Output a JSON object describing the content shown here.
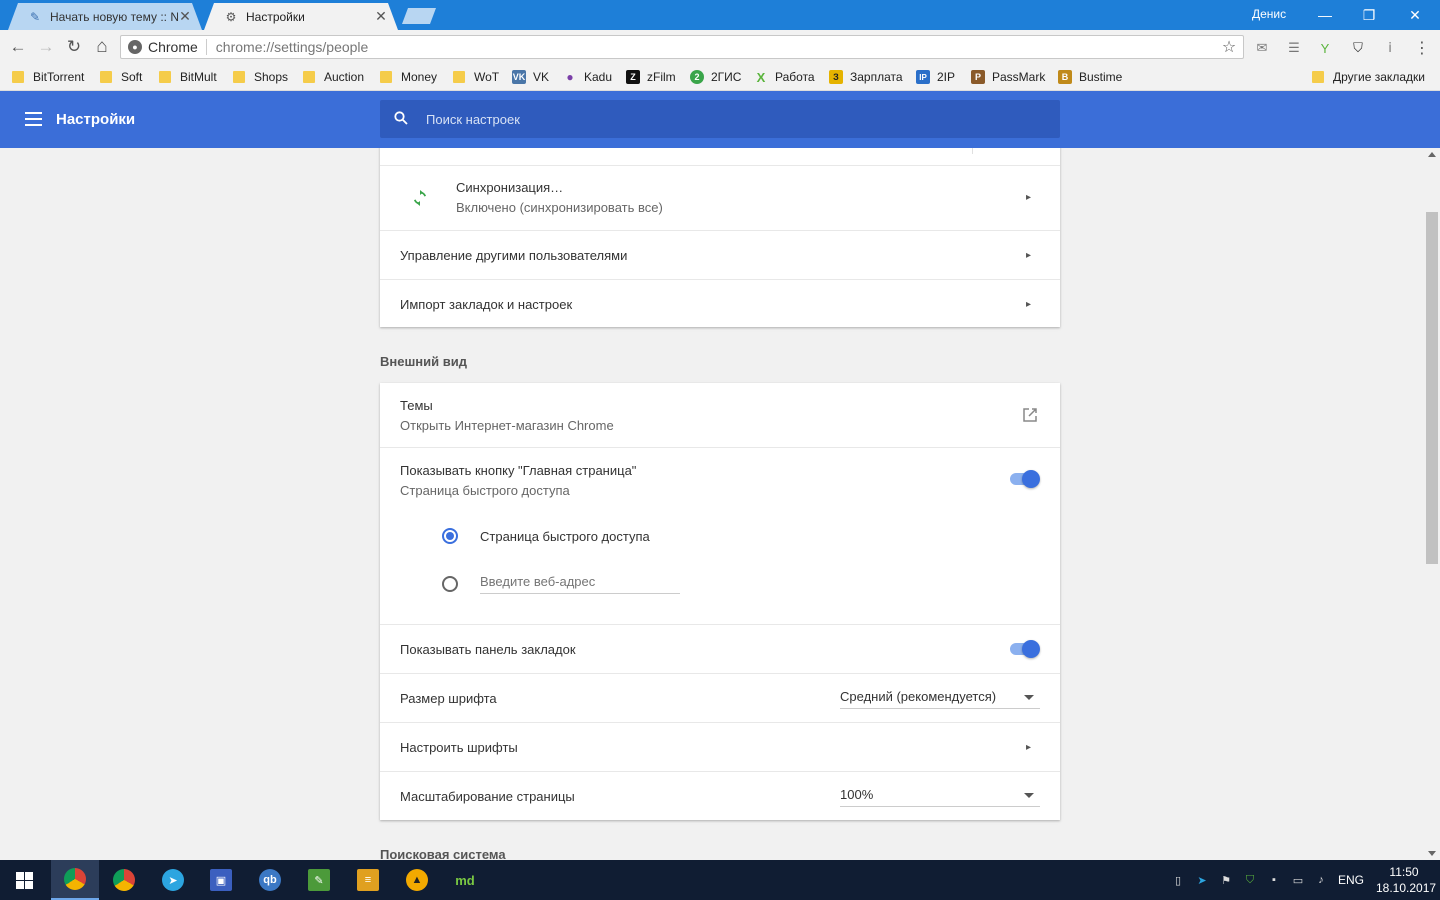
{
  "window": {
    "user_name": "Денис",
    "minimize": "—",
    "maximize": "❐",
    "close": "✕"
  },
  "tabs": [
    {
      "title": "Начать новую тему :: N",
      "close": "✕"
    },
    {
      "title": "Настройки",
      "close": "✕"
    }
  ],
  "toolbar": {
    "back": "←",
    "forward": "→",
    "reload": "↻",
    "home": "⌂",
    "site_chip": "Chrome",
    "url": "chrome://settings/people",
    "star": "☆",
    "menu": "⋮"
  },
  "bookmarks": [
    {
      "label": "BitTorrent",
      "icon": "folder-icon"
    },
    {
      "label": "Soft",
      "icon": "folder-icon"
    },
    {
      "label": "BitMult",
      "icon": "folder-icon"
    },
    {
      "label": "Shops",
      "icon": "folder-icon"
    },
    {
      "label": "Auction",
      "icon": "folder-icon"
    },
    {
      "label": "Money",
      "icon": "folder-icon"
    },
    {
      "label": "WoT",
      "icon": "folder-icon"
    },
    {
      "label": "VK",
      "icon": "vk-icon",
      "glyph": "VK",
      "color": "#4a76a8"
    },
    {
      "label": "Kadu",
      "icon": "kadu-icon",
      "glyph": "●",
      "color": "#7b3fa8"
    },
    {
      "label": "zFilm",
      "icon": "zfilm-icon",
      "glyph": "Z",
      "color": "#111111"
    },
    {
      "label": "2ГИС",
      "icon": "2gis-icon",
      "glyph": "2",
      "color": "#3aa54a"
    },
    {
      "label": "Работа",
      "icon": "rabota-icon",
      "glyph": "X",
      "color": "#5ab43c"
    },
    {
      "label": "Зарплата",
      "icon": "zarplata-icon",
      "glyph": "З",
      "color": "#e5b300"
    },
    {
      "label": "2IP",
      "icon": "2ip-icon",
      "glyph": "IP",
      "color": "#2a6fc9"
    },
    {
      "label": "PassMark",
      "icon": "passmark-icon",
      "glyph": "P",
      "color": "#8a5a2a"
    },
    {
      "label": "Bustime",
      "icon": "bustime-icon",
      "glyph": "B",
      "color": "#c08a1a"
    }
  ],
  "other_bookmarks": "Другие закладки",
  "header": {
    "title": "Настройки",
    "search_placeholder": "Поиск настроек"
  },
  "people": {
    "sync_title": "Синхронизация…",
    "sync_status": "Включено (синхронизировать все)",
    "manage_users": "Управление другими пользователями",
    "import": "Импорт закладок и настроек"
  },
  "appearance": {
    "section_title": "Внешний вид",
    "themes_title": "Темы",
    "themes_sub": "Открыть Интернет-магазин Chrome",
    "home_button_title": "Показывать кнопку \"Главная страница\"",
    "home_button_sub": "Страница быстрого доступа",
    "home_button_enabled": true,
    "radio_ntp": "Страница быстрого доступа",
    "radio_url_placeholder": "Введите веб-адрес",
    "bookmarks_bar": "Показывать панель закладок",
    "bookmarks_bar_enabled": true,
    "font_size_label": "Размер шрифта",
    "font_size_value": "Средний (рекомендуется)",
    "customize_fonts": "Настроить шрифты",
    "zoom_label": "Масштабирование страницы",
    "zoom_value": "100%"
  },
  "search_section_title": "Поисковая система",
  "taskbar": {
    "apps": [
      {
        "name": "chrome-active",
        "color": "#db4437"
      },
      {
        "name": "chrome",
        "color": "#0f9d58"
      },
      {
        "name": "telegram",
        "color": "#2ca5e0"
      },
      {
        "name": "save",
        "color": "#3b5fbf"
      },
      {
        "name": "qbittorrent",
        "color": "#3b78c4"
      },
      {
        "name": "notepad",
        "color": "#4c9a3a"
      },
      {
        "name": "notes",
        "color": "#e0a020"
      },
      {
        "name": "aimp",
        "color": "#f2a900"
      },
      {
        "name": "md",
        "color": "#2d2d2d"
      }
    ],
    "lang": "ENG",
    "time": "11:50",
    "date": "18.10.2017"
  }
}
